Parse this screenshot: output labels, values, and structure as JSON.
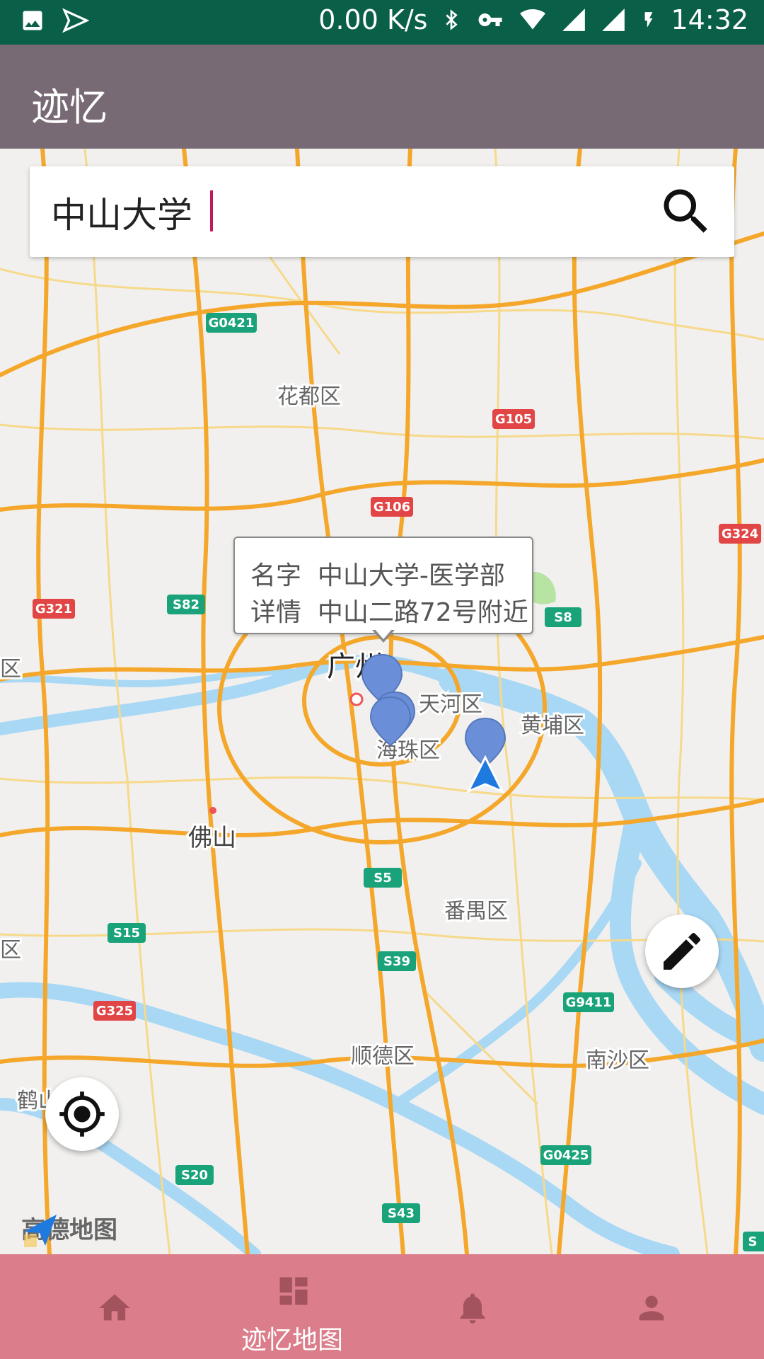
{
  "status_bar": {
    "net_speed": "0.00 K/s",
    "time": "14:32",
    "icons": [
      "image-icon",
      "send-icon",
      "bluetooth-icon",
      "vpn-key-icon",
      "wifi-icon",
      "signal-icon",
      "signal-icon",
      "charging-icon"
    ]
  },
  "app_bar": {
    "title": "迹忆"
  },
  "search": {
    "value": "中山大学",
    "icon": "search-icon"
  },
  "map": {
    "labels": {
      "huadu": "花都区",
      "guangzhou": "广州",
      "tianhe": "天河区",
      "huangpu": "黄埔区",
      "haizhu": "海珠区",
      "foshan": "佛山",
      "panyu": "番禺区",
      "shunde": "顺德区",
      "nansha": "南沙区",
      "heshan": "鹤山",
      "edge_left_1": "区",
      "edge_left_2": "区"
    },
    "shields": {
      "g0421": "G0421",
      "g105": "G105",
      "g106": "G106",
      "g324": "G324",
      "g321": "G321",
      "s82": "S82",
      "s8": "S8",
      "s5": "S5",
      "s15": "S15",
      "s39": "S39",
      "g325": "G325",
      "g9411": "G9411",
      "s20": "S20",
      "g0425": "G0425",
      "s43": "S43",
      "s_edge": "S"
    },
    "info_window": {
      "name_label": "名字",
      "name_value": "中山大学-医学部",
      "detail_label": "详情",
      "detail_value": "中山二路72号附近"
    },
    "logo_text": "高德地图"
  },
  "bottom_nav": {
    "items": [
      {
        "icon": "home-icon",
        "label": ""
      },
      {
        "icon": "dashboard-icon",
        "label": "迹忆地图"
      },
      {
        "icon": "bell-icon",
        "label": ""
      },
      {
        "icon": "person-icon",
        "label": ""
      }
    ]
  },
  "colors": {
    "status_bar": "#0a5f48",
    "app_bar": "#786a74",
    "bottom_nav": "#db7d8a",
    "marker": "#6a8fd8",
    "road_major": "#f4a72a",
    "water": "#a9d8f5",
    "caret": "#c2185b"
  }
}
